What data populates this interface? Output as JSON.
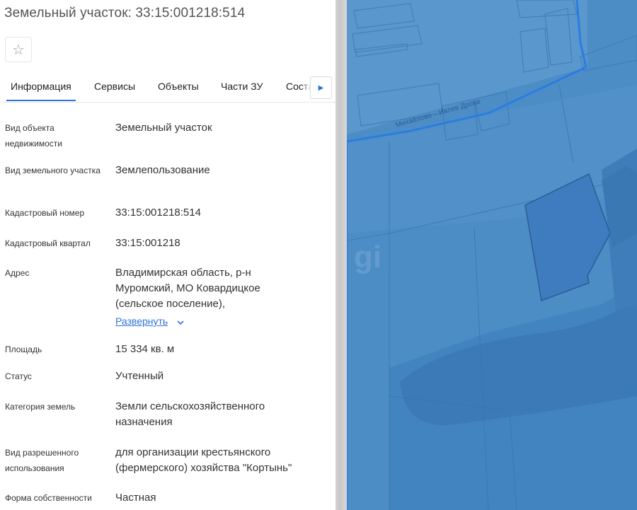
{
  "header": {
    "title": "Земельный участок: 33:15:001218:514"
  },
  "tabs": [
    {
      "label": "Информация"
    },
    {
      "label": "Сервисы"
    },
    {
      "label": "Объекты"
    },
    {
      "label": "Части ЗУ"
    },
    {
      "label": "Соста..."
    }
  ],
  "info": {
    "object_type": {
      "label": "Вид объекта недвижимости",
      "value": "Земельный участок"
    },
    "plot_type": {
      "label": "Вид земельного участка",
      "value": "Землепользование"
    },
    "cadastral_number": {
      "label": "Кадастровый номер",
      "value": "33:15:001218:514"
    },
    "cadastral_quarter": {
      "label": "Кадастровый квартал",
      "value": "33:15:001218"
    },
    "address": {
      "label": "Адрес",
      "value": "Владимирская область, р-н Муромский, МО Ковардицкое (сельское поселение),",
      "expand_label": "Развернуть"
    },
    "area": {
      "label": "Площадь",
      "value": "15 334 кв. м"
    },
    "status": {
      "label": "Статус",
      "value": "Учтенный"
    },
    "land_category": {
      "label": "Категория земель",
      "value": "Земли сельскохозяйственного назначения"
    },
    "permitted_use": {
      "label": "Вид разрешенного использования",
      "value": "для организации крестьянского (фермерского) хозяйства \"Кортынь\""
    },
    "ownership": {
      "label": "Форма собственности",
      "value": "Частная"
    }
  },
  "map": {
    "road_label": "Михайлово – Ивлев Дрова",
    "watermark": "gi",
    "colors": {
      "base": "#4d8dc6",
      "highlight": "#2a7de0",
      "parcel": "#3f7bbf"
    }
  }
}
